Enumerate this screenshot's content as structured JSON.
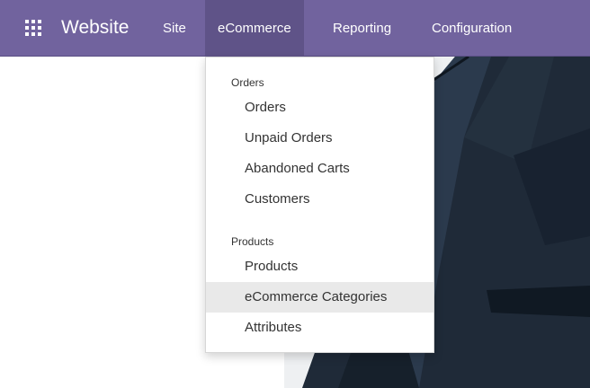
{
  "navbar": {
    "brand": "Website",
    "menu": [
      {
        "label": "Site"
      },
      {
        "label": "eCommerce"
      },
      {
        "label": "Reporting"
      },
      {
        "label": "Configuration"
      }
    ]
  },
  "dropdown": {
    "sections": [
      {
        "header": "Orders",
        "items": [
          "Orders",
          "Unpaid Orders",
          "Abandoned Carts",
          "Customers"
        ]
      },
      {
        "header": "Products",
        "items": [
          "Products",
          "eCommerce Categories",
          "Attributes"
        ]
      }
    ],
    "highlighted_item": "eCommerce Categories"
  },
  "colors": {
    "navbar_bg": "#71639e",
    "active_nav_bg": "#5f5388",
    "hover_bg": "#e9e9e9"
  }
}
